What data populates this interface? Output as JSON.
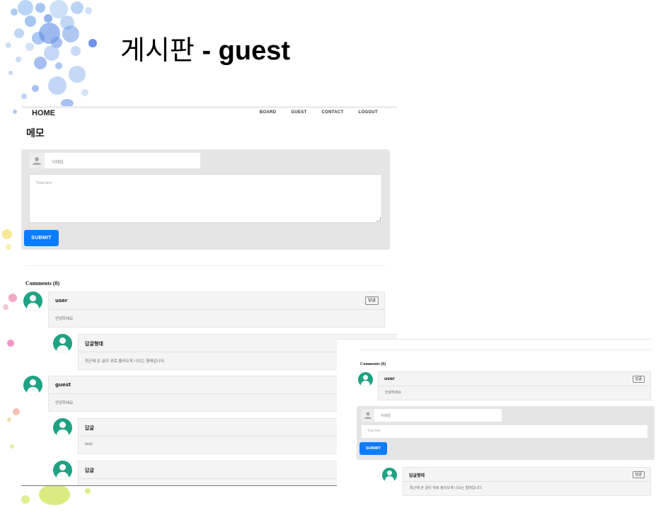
{
  "slide": {
    "title_korean": "게시판",
    "title_rest": " - guest"
  },
  "colors": {
    "accent": "#0a7cff",
    "avatar": "#1ea283",
    "form_bg": "#e5e5e5",
    "comment_bg": "#f4f4f4"
  },
  "nav": {
    "home": "HOME",
    "links": [
      "BOARD",
      "GUEST",
      "CONTACT",
      "LOGOUT"
    ]
  },
  "memo": {
    "title": "메모",
    "name_placeholder": "닉네임",
    "text_placeholder": "Your text",
    "submit": "SUBMIT"
  },
  "comments_header": "Comments (8)",
  "comments": [
    {
      "author": "user",
      "text": "안녕하세요",
      "reply_button": "답글",
      "icon": "user-avatar-icon"
    },
    {
      "author": "답글형태",
      "text": "최근에 쓴 글이 위로 올라오게 나오는 형태입니다.",
      "icon": "user-avatar-icon"
    },
    {
      "author": "guest",
      "text": "안녕하세요",
      "icon": "user-avatar-icon"
    },
    {
      "author": "답글",
      "text": "test",
      "icon": "user-avatar-icon"
    },
    {
      "author": "답글",
      "text": "",
      "icon": "user-avatar-icon"
    }
  ],
  "detail": {
    "comments_header": "Comments (8)",
    "comment": {
      "author": "user",
      "text": "안녕하세요",
      "reply_button": "답글"
    },
    "reply_form": {
      "name_placeholder": "닉네임",
      "text_placeholder": "Your text",
      "submit": "SUBMIT"
    },
    "reply": {
      "author": "답글형태",
      "text": "최근에 쓴 글이 위로 올라오게 나오는 형태입니다.",
      "reply_button": "답글"
    }
  }
}
